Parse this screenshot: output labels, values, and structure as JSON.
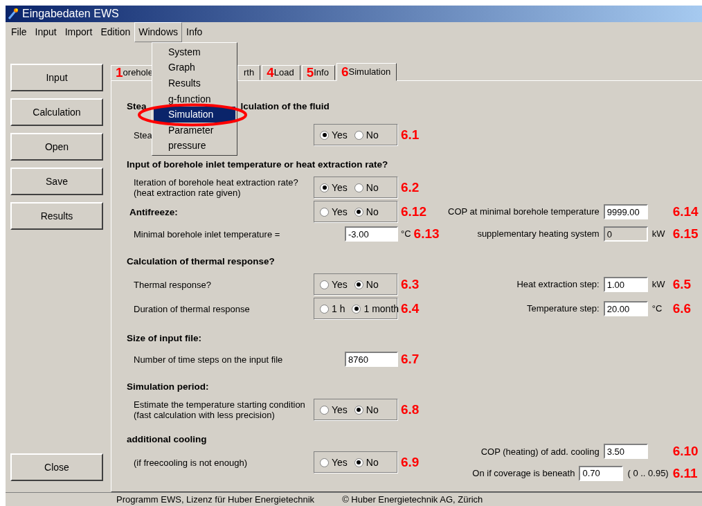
{
  "window": {
    "title": "Eingabedaten EWS"
  },
  "menu_bar": [
    {
      "label": "File",
      "selected": false
    },
    {
      "label": "Input",
      "selected": false
    },
    {
      "label": "Import",
      "selected": false
    },
    {
      "label": "Edition",
      "selected": false
    },
    {
      "label": "Windows",
      "selected": true
    },
    {
      "label": "Info",
      "selected": false
    }
  ],
  "windows_menu": [
    {
      "label": "System",
      "selected": false,
      "circled": false
    },
    {
      "label": "Graph",
      "selected": false,
      "circled": false
    },
    {
      "label": "Results",
      "selected": false,
      "circled": false
    },
    {
      "label": "g-function",
      "selected": false,
      "circled": false
    },
    {
      "label": "Simulation",
      "selected": true,
      "circled": true
    },
    {
      "label": "Parameter",
      "selected": false,
      "circled": false
    },
    {
      "label": "pressure",
      "selected": false,
      "circled": false
    }
  ],
  "side_buttons": [
    "Input",
    "Calculation",
    "Open",
    "Save",
    "Results"
  ],
  "close_button": "Close",
  "tabs": [
    {
      "label": "orehole",
      "marker": "1",
      "selected": false
    },
    {
      "label": "rth",
      "selected": false
    },
    {
      "label": "Load",
      "marker": "4",
      "selected": false
    },
    {
      "label": "Info",
      "marker": "5",
      "selected": false
    },
    {
      "label": "Simulation",
      "marker": "6",
      "selected": true
    }
  ],
  "sections": [
    {
      "heading": [
        "Stea",
        "lculation of the fluid"
      ],
      "rows": [
        {
          "kind": "radio",
          "label": [
            "Stea"
          ],
          "options": [
            {
              "label": "Yes",
              "selected": true
            },
            {
              "label": "No",
              "selected": false
            }
          ],
          "marker": "6.1"
        }
      ]
    },
    {
      "heading": [
        "Input of borehole inlet temperature or heat extraction rate?"
      ],
      "rows": [
        {
          "kind": "radio",
          "label": [
            "Iteration of borehole heat extraction rate?",
            "(heat extraction rate given)"
          ],
          "options": [
            {
              "label": "Yes",
              "selected": true
            },
            {
              "label": "No",
              "selected": false
            }
          ],
          "marker": "6.2"
        },
        {
          "kind": "radio",
          "bold": true,
          "label": [
            "Antifreeze:"
          ],
          "options": [
            {
              "label": "Yes",
              "selected": false
            },
            {
              "label": "No",
              "selected": true
            }
          ],
          "marker": "6.12",
          "asides": [
            {
              "label": "COP at minimal borehole temperature",
              "value": "9999.00",
              "disabled": false,
              "marker": "6.14"
            }
          ]
        },
        {
          "kind": "field",
          "label": [
            "Minimal borehole inlet temperature ="
          ],
          "value": "-3.00",
          "unit": "°C",
          "marker": "6.13",
          "asides": [
            {
              "label": "supplementary heating system",
              "value": "0",
              "disabled": true,
              "unit": "kW",
              "marker": "6.15"
            }
          ]
        }
      ]
    },
    {
      "heading": [
        "Calculation of thermal response?"
      ],
      "rows": [
        {
          "kind": "radio",
          "label": [
            "Thermal response?"
          ],
          "options": [
            {
              "label": "Yes",
              "selected": false
            },
            {
              "label": "No",
              "selected": true
            }
          ],
          "marker": "6.3",
          "asides": [
            {
              "label": "Heat extraction step:",
              "value": "1.00",
              "disabled": false,
              "unit": "kW",
              "marker": "6.5"
            }
          ]
        },
        {
          "kind": "radio",
          "label": [
            "Duration of thermal response"
          ],
          "options": [
            {
              "label": "1 h",
              "selected": false
            },
            {
              "label": "1 month",
              "selected": true
            }
          ],
          "marker": "6.4",
          "asides": [
            {
              "label": "Temperature step:",
              "value": "20.00",
              "disabled": false,
              "unit": "°C",
              "marker": "6.6"
            }
          ]
        }
      ]
    },
    {
      "heading": [
        "Size of input file:"
      ],
      "rows": [
        {
          "kind": "field",
          "label": [
            "Number of time steps on the input file"
          ],
          "value": "8760",
          "marker": "6.7"
        }
      ]
    },
    {
      "heading": [
        "Simulation period:"
      ],
      "rows": [
        {
          "kind": "radio",
          "label": [
            "Estimate the temperature starting condition",
            "(fast calculation with less precision)"
          ],
          "options": [
            {
              "label": "Yes",
              "selected": false
            },
            {
              "label": "No",
              "selected": true
            }
          ],
          "marker": "6.8"
        }
      ]
    },
    {
      "heading": [
        "additional cooling"
      ],
      "rows": [
        {
          "kind": "radio",
          "label": [
            "(if freecooling is not enough)"
          ],
          "options": [
            {
              "label": "Yes",
              "selected": false
            },
            {
              "label": "No",
              "selected": true
            }
          ],
          "marker": "6.9",
          "asides": [
            {
              "label": "COP (heating) of add. cooling",
              "value": "3.50",
              "disabled": false,
              "marker": "6.10"
            },
            {
              "label": "On if coverage is beneath",
              "value": "0.70",
              "disabled": false,
              "unit": "( 0 .. 0.95)",
              "marker": "6.11"
            }
          ]
        }
      ]
    }
  ],
  "status_bar": [
    "Programm EWS, Lizenz für Huber Energietechnik",
    "© Huber Energietechnik AG, Zürich"
  ]
}
